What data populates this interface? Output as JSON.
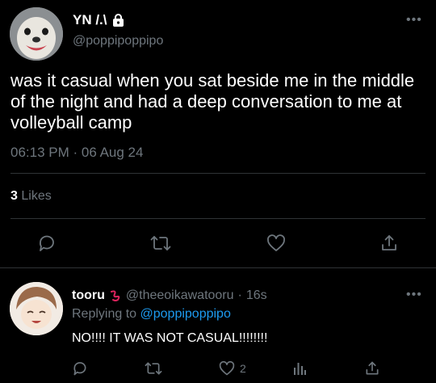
{
  "tweet": {
    "author_name": "YN /.\\",
    "handle": "@poppipoppipo",
    "text": "was it casual when you sat beside me in the middle of the night and had a deep conversation to me at volleyball camp",
    "time": "06:13 PM · 06 Aug 24",
    "likes_count": "3",
    "likes_label": "Likes"
  },
  "reply": {
    "author_name": "tooru",
    "handle": "@theeoikawatooru",
    "dot": "·",
    "age": "16s",
    "replying_prefix": "Replying to",
    "replying_to": "@poppipoppipo",
    "text": "NO!!!! IT WAS NOT CASUAL!!!!!!!!",
    "like_count": "2"
  },
  "colors": {
    "background": "#000000",
    "text": "#e7e9ea",
    "muted": "#6e767d",
    "link": "#1d9bf0",
    "divider": "#2f3336",
    "heart_emoji": "#e0245e"
  },
  "icons": {
    "lock": "lock-icon",
    "more": "more-icon",
    "reply": "reply-icon",
    "retweet": "retweet-icon",
    "like": "heart-icon",
    "share": "share-icon",
    "analytics": "analytics-icon"
  }
}
